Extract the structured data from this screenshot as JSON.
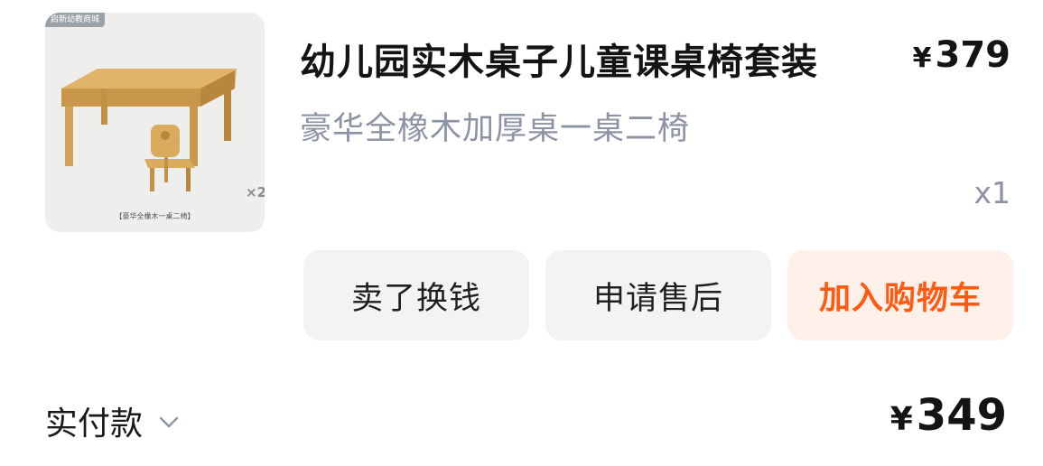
{
  "product": {
    "image_tag": "启新幼教商城",
    "image_caption": "【豪华全橡木一桌二椅】",
    "image_badge": "×2",
    "title": "幼儿园实木桌子儿童课桌椅套装",
    "currency": "¥",
    "price": "379",
    "spec": "豪华全橡木加厚桌一桌二椅",
    "quantity": "x1"
  },
  "actions": {
    "sell_label": "卖了换钱",
    "aftersale_label": "申请售后",
    "cart_label": "加入购物车"
  },
  "payment": {
    "label": "实付款",
    "currency": "¥",
    "amount": "349"
  },
  "colors": {
    "accent": "#ff5a14",
    "accent_bg": "#fff0ea",
    "button_bg": "#f2f3f5",
    "muted_text": "#8c93a3"
  }
}
